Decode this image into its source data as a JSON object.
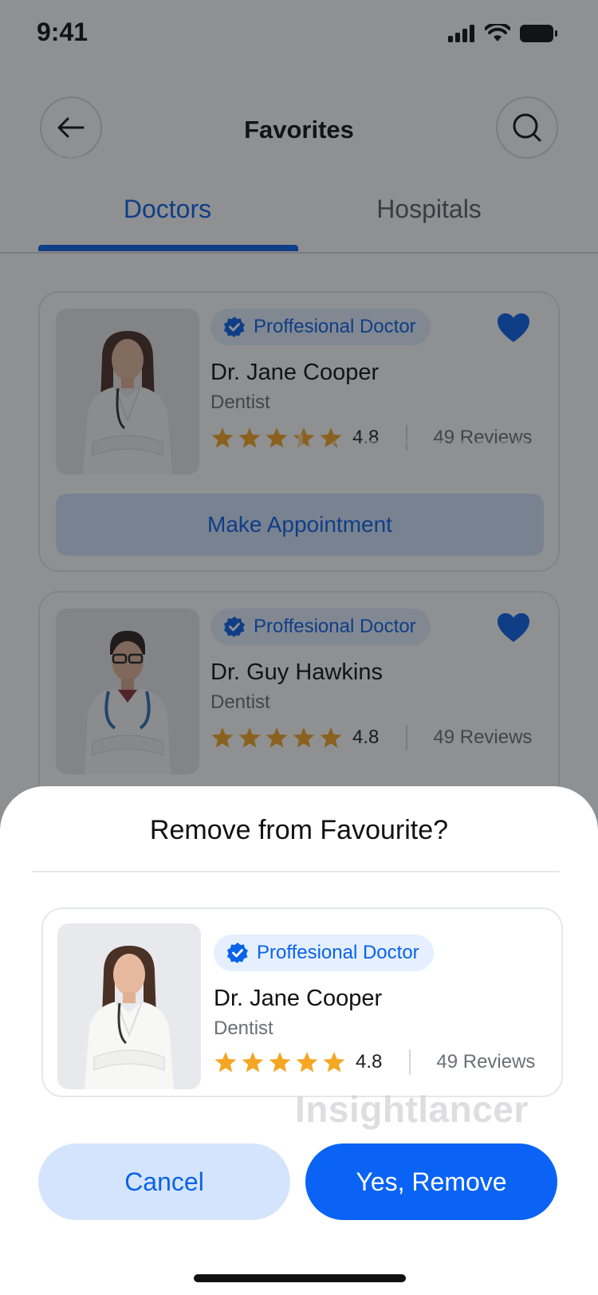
{
  "status_bar": {
    "time": "9:41"
  },
  "header": {
    "title": "Favorites"
  },
  "tabs": [
    {
      "label": "Doctors",
      "active": true
    },
    {
      "label": "Hospitals",
      "active": false
    }
  ],
  "doctors": [
    {
      "badge": "Proffesional Doctor",
      "name": "Dr. Jane Cooper",
      "specialty": "Dentist",
      "rating": "4.8",
      "reviews": "49 Reviews",
      "button": "Make Appointment"
    },
    {
      "badge": "Proffesional Doctor",
      "name": "Dr. Guy Hawkins",
      "specialty": "Dentist",
      "rating": "4.8",
      "reviews": "49 Reviews"
    }
  ],
  "sheet": {
    "title": "Remove from Favourite?",
    "doctor": {
      "badge": "Proffesional Doctor",
      "name": "Dr. Jane Cooper",
      "specialty": "Dentist",
      "rating": "4.8",
      "reviews": "49 Reviews"
    },
    "cancel_label": "Cancel",
    "confirm_label": "Yes, Remove"
  },
  "watermark": "Insightlancer",
  "colors": {
    "primary": "#0a63e8",
    "primary_light": "#d5e4fd",
    "star": "#f5a623",
    "overlay": "rgba(20,22,28,0.48)"
  }
}
